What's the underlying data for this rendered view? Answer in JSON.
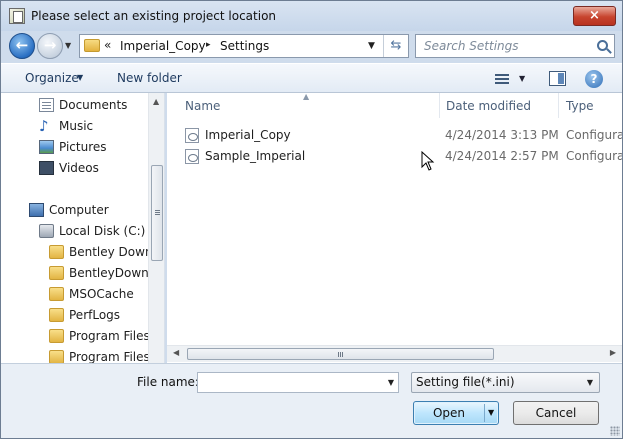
{
  "window": {
    "title": "Please select an existing project location",
    "close_label": "×"
  },
  "address_bar": {
    "overflow_chevron": "«",
    "segments": [
      "Imperial_Copy",
      "Settings"
    ],
    "separator": "▸"
  },
  "search": {
    "placeholder": "Search Settings"
  },
  "toolbar": {
    "organize_label": "Organize",
    "new_folder_label": "New folder",
    "help_label": "?"
  },
  "nav_pane": {
    "items": [
      {
        "label": "Documents",
        "icon": "documents-icon"
      },
      {
        "label": "Music",
        "icon": "music-icon"
      },
      {
        "label": "Pictures",
        "icon": "pictures-icon"
      },
      {
        "label": "Videos",
        "icon": "videos-icon"
      },
      {
        "label": "Computer",
        "icon": "computer-icon"
      },
      {
        "label": "Local Disk (C:)",
        "icon": "disk-icon"
      },
      {
        "label": "Bentley Downlo",
        "icon": "folder-icon"
      },
      {
        "label": "BentleyDownlo",
        "icon": "folder-icon"
      },
      {
        "label": "MSOCache",
        "icon": "folder-icon"
      },
      {
        "label": "PerfLogs",
        "icon": "folder-icon"
      },
      {
        "label": "Program Files",
        "icon": "folder-icon"
      },
      {
        "label": "Program Files (",
        "icon": "folder-icon"
      }
    ]
  },
  "file_list": {
    "columns": [
      "Name",
      "Date modified",
      "Type"
    ],
    "rows": [
      {
        "name": "Imperial_Copy",
        "date": "4/24/2014 3:13 PM",
        "type": "Configura"
      },
      {
        "name": "Sample_Imperial",
        "date": "4/24/2014 2:57 PM",
        "type": "Configura"
      }
    ]
  },
  "bottom": {
    "file_name_label": "File name:",
    "file_name_value": "",
    "filter_value": "Setting file(*.ini)",
    "open_label": "Open",
    "cancel_label": "Cancel"
  },
  "colors": {
    "accent": "#3c7fb1",
    "close": "#c7442e",
    "toolbar_text": "#1e3a5f"
  }
}
